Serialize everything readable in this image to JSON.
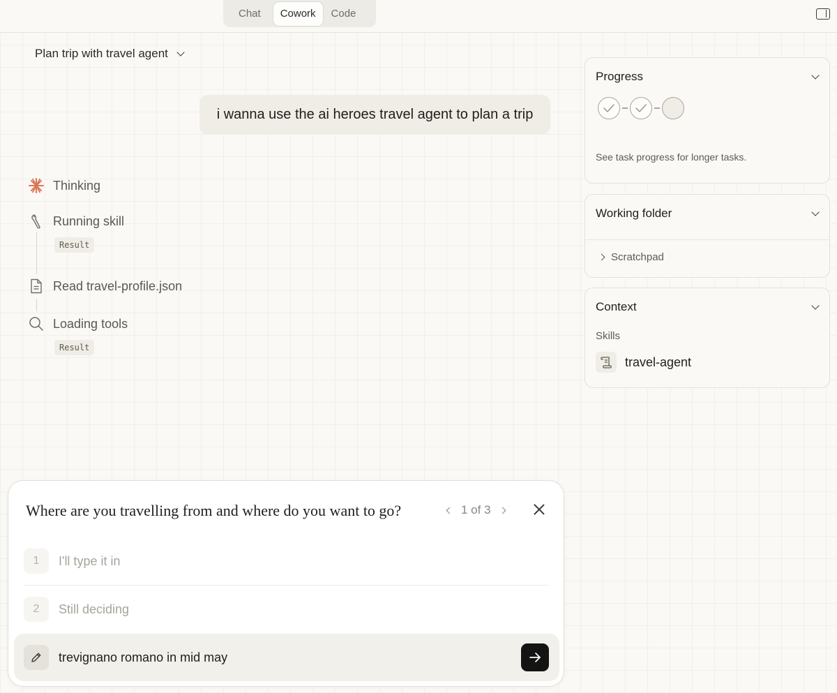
{
  "header": {
    "tabs": [
      {
        "label": "Chat",
        "active": false
      },
      {
        "label": "Cowork",
        "active": true
      },
      {
        "label": "Code",
        "active": false
      }
    ]
  },
  "task": {
    "title": "Plan trip with travel agent"
  },
  "conversation": {
    "user_message": "i wanna use the ai heroes travel agent to plan a trip",
    "thinking_label": "Thinking",
    "steps": [
      {
        "label": "Running skill",
        "icon": "wrench-icon",
        "result": "Result"
      },
      {
        "label": "Read travel-profile.json",
        "icon": "document-icon"
      },
      {
        "label": "Loading tools",
        "icon": "search-icon",
        "result": "Result"
      }
    ]
  },
  "panels": {
    "progress": {
      "title": "Progress",
      "note": "See task progress for longer tasks.",
      "steps_done": 2,
      "steps_total": 3
    },
    "working_folder": {
      "title": "Working folder",
      "item": "Scratchpad"
    },
    "context": {
      "title": "Context",
      "skills_label": "Skills",
      "skill": "travel-agent"
    }
  },
  "question_card": {
    "question": "Where are you travelling from and where do you want to go?",
    "pager": "1 of 3",
    "options": [
      {
        "num": "1",
        "label": "I'll type it in"
      },
      {
        "num": "2",
        "label": "Still deciding"
      }
    ],
    "input_value": "trevignano romano in mid may"
  },
  "colors": {
    "accent": "#d97757",
    "background": "#faf9f5",
    "send_button": "#141413"
  }
}
